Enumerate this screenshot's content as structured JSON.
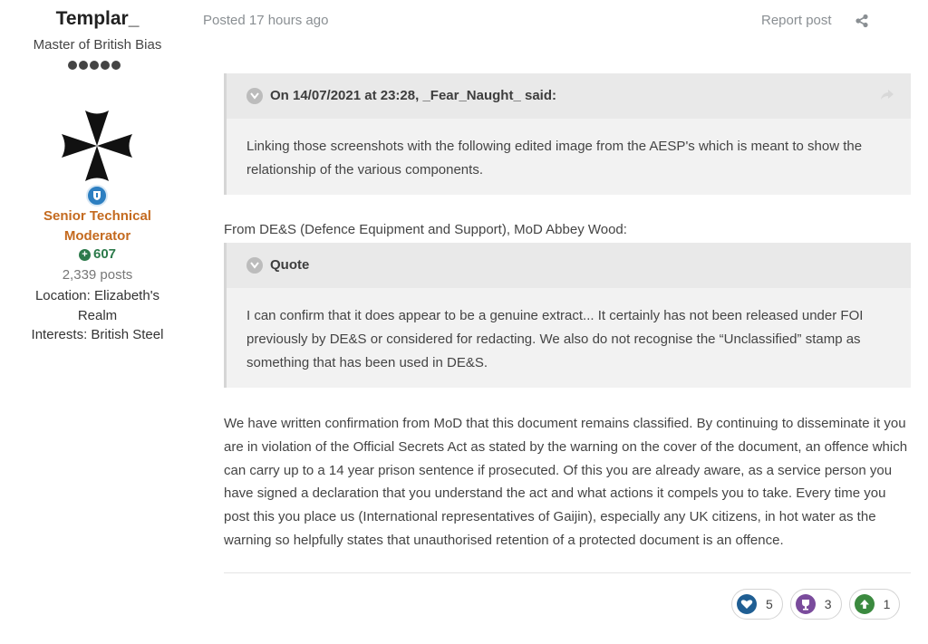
{
  "author": {
    "name": "Templar_",
    "title": "Master of British Bias",
    "group": "Senior Technical Moderator",
    "reputation": "607",
    "posts": "2,339 posts",
    "location": "Location: Elizabeth's Realm",
    "interests": "Interests: British Steel",
    "rank_pips": 5,
    "colors": {
      "group": "#c46a1f",
      "reputation": "#2c7a4b"
    }
  },
  "post": {
    "posted": "Posted 17 hours ago",
    "report": "Report post",
    "share_icon": "share-icon"
  },
  "quote1": {
    "header": "On 14/07/2021 at 23:28, _Fear_Naught_ said:",
    "body": "Linking those screenshots with the following edited image from the AESP's which is meant to show the relationship of the various components."
  },
  "from_line": "From DE&S (Defence Equipment and Support), MoD Abbey Wood:",
  "quote2": {
    "header": "Quote",
    "body": "I can confirm that it does appear to be a genuine extract...  It certainly has not been released under FOI previously by DE&S or considered for redacting.  We also do not recognise the “Unclassified” stamp as something that has been used in DE&S."
  },
  "main_text": "We have written confirmation from MoD that this document remains classified. By continuing to disseminate it you are in violation of the Official Secrets Act as stated by the warning on the cover of the document, an offence which can carry up to a 14 year prison sentence if prosecuted. Of this you are already aware, as a service person you have signed a declaration that you understand the act and what actions it compels you to take. Every time you post this you place us (International representatives of Gaijin), especially any UK citizens, in hot water as the warning so helpfully states that unauthorised retention of a protected document is an offence.",
  "reactions": [
    {
      "name": "like",
      "icon": "heart-icon",
      "count": "5",
      "color": "#1f5e93"
    },
    {
      "name": "thanks",
      "icon": "trophy-icon",
      "count": "3",
      "color": "#7a4b9c"
    },
    {
      "name": "upvote",
      "icon": "up-arrow-icon",
      "count": "1",
      "color": "#3b8a3f"
    }
  ]
}
